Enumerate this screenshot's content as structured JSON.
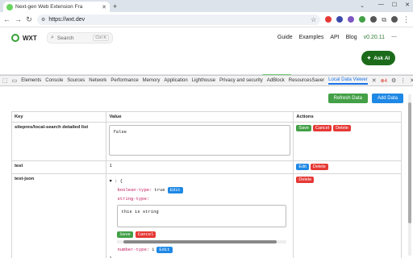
{
  "browser": {
    "tab_title": "Next-gen Web Extension Fra",
    "url": "https://wxt.dev"
  },
  "site": {
    "logo": "WXT",
    "search_placeholder": "Search",
    "search_shortcut": "Ctrl K",
    "nav": [
      "Guide",
      "Examples",
      "API",
      "Blog"
    ],
    "version": "v0.20.11",
    "ask_ai": "Ask AI"
  },
  "devtools": {
    "tabs": [
      "Elements",
      "Console",
      "Sources",
      "Network",
      "Performance",
      "Memory",
      "Application",
      "Lighthouse",
      "Privacy and security",
      "AdBlock",
      "ResourcesSaver",
      "Local Data Viewer"
    ],
    "active_tab": "Local Data Viewer",
    "error_count": "4"
  },
  "viewer": {
    "refresh_label": "Refresh Data",
    "add_label": "Add Data",
    "headers": {
      "key": "Key",
      "value": "Value",
      "actions": "Actions"
    },
    "rows": [
      {
        "key": "sitepres/local-search detailed list",
        "value": "false",
        "actions": [
          "Save",
          "Cancel",
          "Delete"
        ]
      },
      {
        "key": "test",
        "value": "1",
        "actions": [
          "Edit",
          "Delete"
        ]
      },
      {
        "key": "test-json",
        "actions": [
          "Delete"
        ]
      }
    ],
    "json": {
      "open": "▼ : {",
      "boolean_key": "boolean-type:",
      "boolean_val": "true",
      "edit_label": "Edit",
      "string_key": "string-type:",
      "string_val": "this is string",
      "save_label": "Save",
      "cancel_label": "Cancel",
      "number_key": "number-type:",
      "number_val": "1",
      "close": "}"
    }
  }
}
